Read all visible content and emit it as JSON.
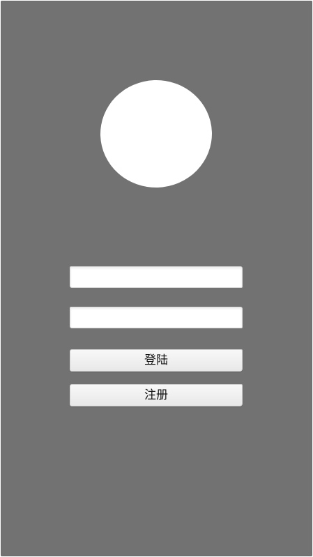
{
  "login_form": {
    "username_value": "",
    "password_value": "",
    "login_label": "登陆",
    "register_label": "注册"
  },
  "colors": {
    "background": "#727272",
    "avatar": "#ffffff",
    "field": "#ffffff",
    "button": "#f2f2f2",
    "button_text": "#111111"
  }
}
